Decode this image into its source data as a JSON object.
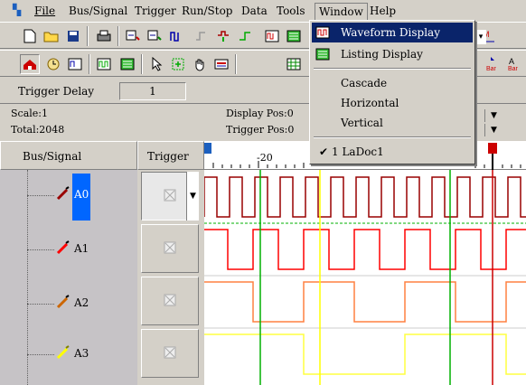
{
  "menubar": {
    "items": [
      "File",
      "Bus/Signal",
      "Trigger",
      "Run/Stop",
      "Data",
      "Tools",
      "Window",
      "Help"
    ],
    "active": "Window"
  },
  "window_menu": {
    "items": [
      "Waveform Display",
      "Listing Display",
      "Cascade",
      "Horizontal",
      "Vertical",
      "1 LaDoc1"
    ],
    "highlighted": "Waveform Display",
    "checked": "1 LaDoc1"
  },
  "trigger_delay": {
    "label": "Trigger Delay",
    "value": "1"
  },
  "info": {
    "scale": "Scale:1",
    "total": "Total:2048",
    "display_pos": "Display Pos:0",
    "trigger_pos": "Trigger Pos:0"
  },
  "columns": {
    "bus_signal": "Bus/Signal",
    "trigger": "Trigger"
  },
  "ruler": {
    "tick_label": "-20"
  },
  "signals": [
    {
      "name": "A0",
      "color": "#990000",
      "selected": true
    },
    {
      "name": "A1",
      "color": "#ff0000",
      "selected": false
    },
    {
      "name": "A2",
      "color": "#cc6600",
      "selected": false
    },
    {
      "name": "A3",
      "color": "#ffff00",
      "selected": false
    }
  ],
  "colors": {
    "highlight": "#0a246a",
    "selection": "#0066ff",
    "a0_wave": "#990000",
    "a1_wave": "#ff0000",
    "a2_wave": "#ff8040",
    "a3_wave": "#ffff40",
    "cursor_green": "#00b000",
    "cursor_yellow": "#ffff00",
    "cursor_red": "#cc0000"
  },
  "icons": [
    "new-icon",
    "open-icon",
    "save-icon",
    "print-icon",
    "waveform-icon",
    "listing-icon",
    "cascade-icon",
    "horizontal-icon",
    "vertical-icon",
    "home-icon",
    "clock-icon",
    "pointer-icon",
    "zoom-icon",
    "hand-icon"
  ]
}
